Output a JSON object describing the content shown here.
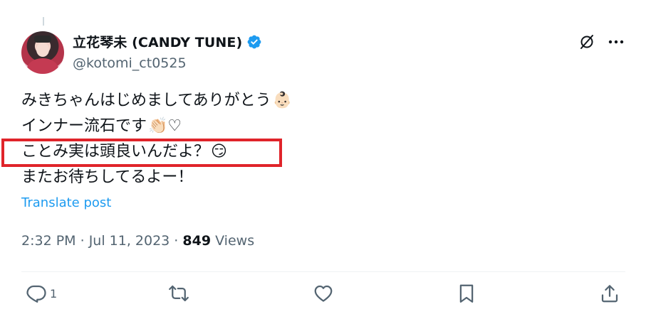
{
  "author": {
    "display_name": "立花琴未 (CANDY TUNE)",
    "handle": "@kotomi_ct0525"
  },
  "tweet": {
    "lines": [
      "みきちゃんはじめましてありがとう",
      "インナー流石です",
      "ことみ実は頭良いんだよ？",
      "またお待ちしてるよー！"
    ],
    "emojis": [
      "👶🏻",
      "👏🏻♡",
      "😏"
    ],
    "translate_label": "Translate post"
  },
  "meta": {
    "time": "2:32 PM",
    "separator1": " · ",
    "date": "Jul 11, 2023",
    "separator2": " · ",
    "views_count": "849",
    "views_label": " Views"
  },
  "actions": {
    "reply_count": "1"
  },
  "colors": {
    "link": "#1d9bf0",
    "verified": "#1d9bf0",
    "highlight": "#e0242a",
    "secondary_text": "#536471"
  },
  "icons": [
    "verified-badge-icon",
    "grok-icon",
    "more-icon",
    "reply-icon",
    "repost-icon",
    "like-icon",
    "bookmark-icon",
    "share-icon"
  ]
}
